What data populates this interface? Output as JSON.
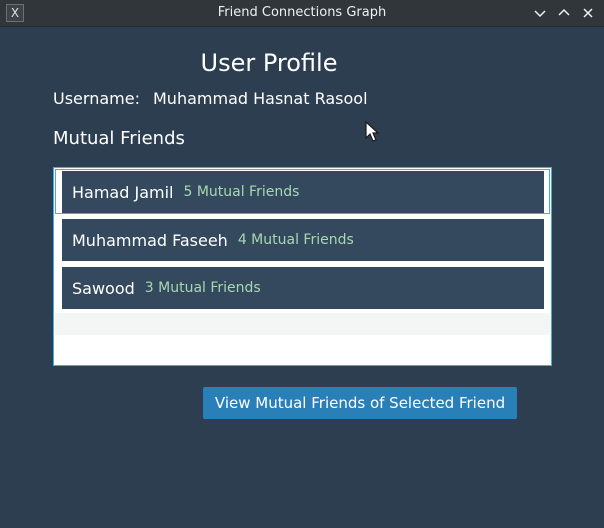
{
  "window": {
    "title": "Friend Connections Graph",
    "app_icon_glyph": "X",
    "controls": [
      "chevron-down-icon",
      "chevron-up-icon",
      "close-icon"
    ]
  },
  "profile": {
    "title": "User Profile",
    "username_label": "Username:",
    "username_value": "Muhammad Hasnat Rasool"
  },
  "mutual": {
    "heading": "Mutual Friends",
    "friends": [
      {
        "name": "Hamad Jamil",
        "count": "5 Mutual Friends",
        "selected": true
      },
      {
        "name": "Muhammad Faseeh",
        "count": "4 Mutual Friends",
        "selected": false
      },
      {
        "name": "Sawood",
        "count": "3 Mutual Friends",
        "selected": false
      }
    ]
  },
  "actions": {
    "view_button_label": "View Mutual Friends of Selected Friend"
  },
  "colors": {
    "background": "#2c3e50",
    "row_background": "#34495e",
    "count_text": "#a8d8b0",
    "button": "#2980b9",
    "focus_border": "#3daee9"
  }
}
